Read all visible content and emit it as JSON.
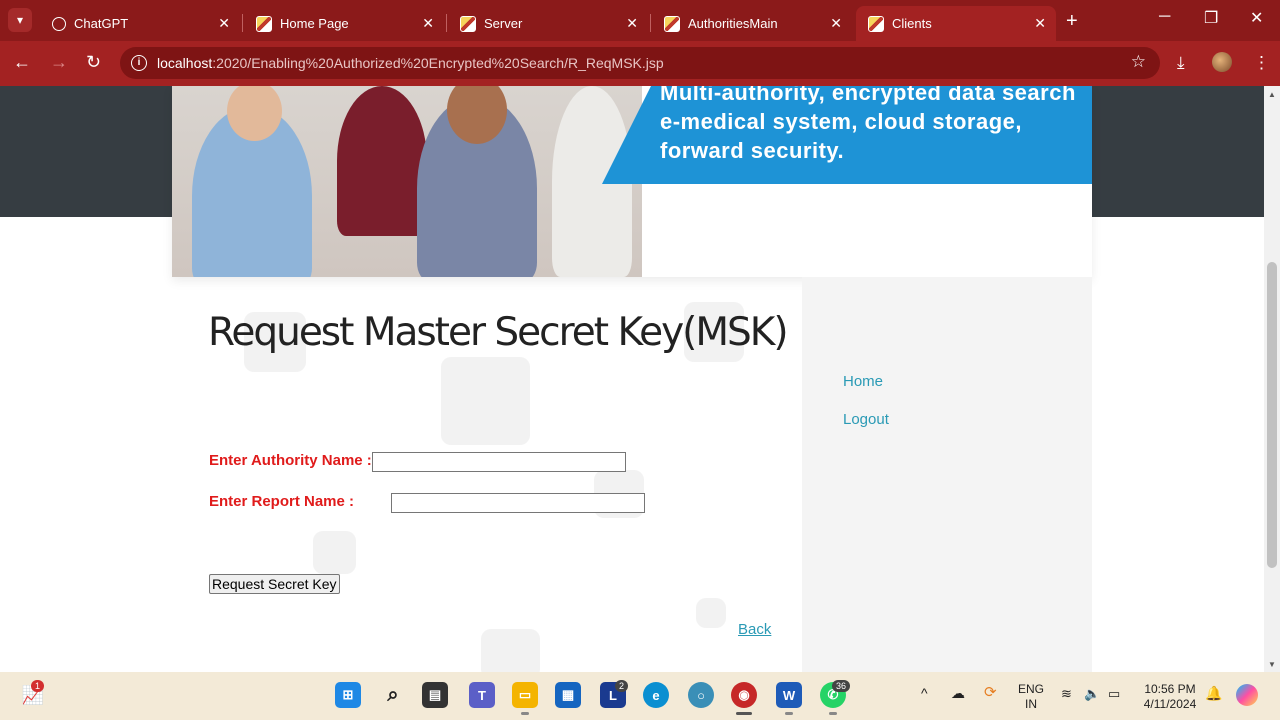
{
  "browser": {
    "tabs": [
      {
        "label": "ChatGPT",
        "active": false
      },
      {
        "label": "Home Page",
        "active": false
      },
      {
        "label": "Server",
        "active": false
      },
      {
        "label": "AuthoritiesMain",
        "active": false
      },
      {
        "label": "Clients",
        "active": true
      }
    ],
    "url_host": "localhost",
    "url_path": ":2020/Enabling%20Authorized%20Encrypted%20Search/R_ReqMSK.jsp"
  },
  "banner": {
    "line1": "Multi-authority, encrypted data search",
    "line2": "e-medical system, cloud storage,",
    "line3": "forward security."
  },
  "page": {
    "title": "Request Master Secret Key(MSK)",
    "authority_label": "Enter Authority Name :",
    "authority_value": "",
    "report_label": "Enter Report Name :",
    "report_value": "",
    "submit_label": "Request Secret Key",
    "back_label": "Back"
  },
  "sidebar": {
    "links": [
      {
        "label": "Home"
      },
      {
        "label": "Logout"
      }
    ]
  },
  "taskbar": {
    "widget_badge": "1",
    "loop_badge": "2",
    "whatsapp_badge": "36",
    "lang_line1": "ENG",
    "lang_line2": "IN",
    "time": "10:56 PM",
    "date": "4/11/2024"
  },
  "colors": {
    "chrome_frame": "#8b1a1a",
    "toolbar": "#a32222",
    "label_red": "#e01b1b",
    "link_teal": "#2a9ab5",
    "banner_blue": "#1e93d6"
  }
}
